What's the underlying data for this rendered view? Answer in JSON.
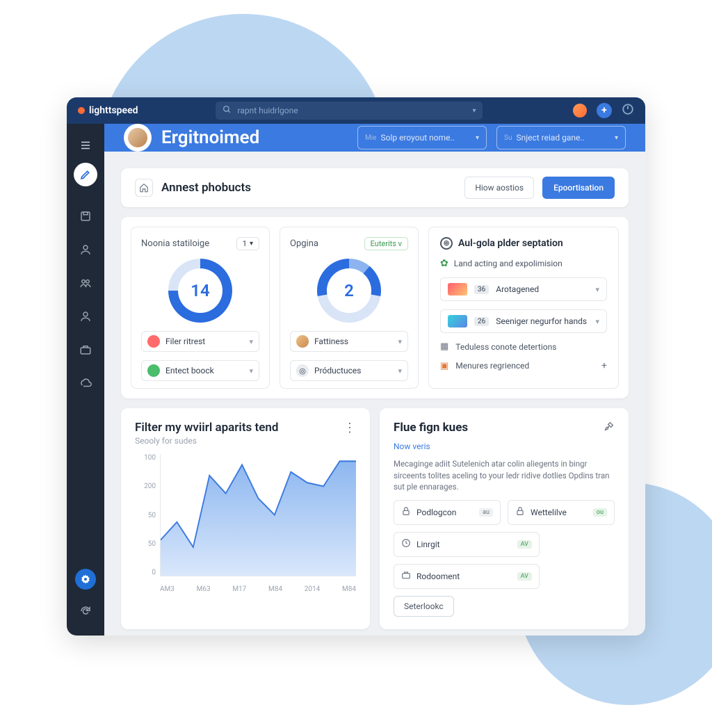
{
  "brand": "lighttspeed",
  "search": {
    "placeholder": "rapnt huidrlgone"
  },
  "hero": {
    "title": "Ergitnoimed",
    "select1_prefix": "Mie",
    "select1": "Solp eroyout nome..",
    "select2_prefix": "Su",
    "select2": "Snject reiad gane.."
  },
  "toolbar": {
    "title": "Annest phobucts",
    "btn_outline": "Hiow aostios",
    "btn_primary": "Epoortisation"
  },
  "gauge1": {
    "title": "Noonia statiloige",
    "badge": "1",
    "value": "14",
    "dd1": "Filer ritrest",
    "dd2": "Entect boock"
  },
  "gauge2": {
    "title": "Opgina",
    "badge": "Euterits v",
    "value": "2",
    "dd1": "Fattiness",
    "dd2": "Próductuces"
  },
  "rpanel": {
    "title": "Aul-gola plder septation",
    "sub": "Land acting and expolimision",
    "row1_num": "36",
    "row1": "Arotagened",
    "row2_num": "26",
    "row2": "Seeniger negurfor hands",
    "line1": "Teduless conote detertions",
    "line2": "Menures regrienced"
  },
  "chart": {
    "title": "Filter my wviirl aparits tend",
    "sub": "Seooly for sudes"
  },
  "chart_data": {
    "type": "area",
    "title": "Filter my wviirl aparits tend",
    "xlabel": "",
    "ylabel": "",
    "ytick_labels": [
      "100",
      "200",
      "50",
      "50",
      "0"
    ],
    "categories": [
      "AM3",
      "M63",
      "M17",
      "M84",
      "2014",
      "M84"
    ],
    "series": [
      {
        "name": "main",
        "values": [
          40,
          60,
          30,
          95,
          80,
          100,
          78,
          65,
          98,
          90,
          85,
          100
        ]
      }
    ],
    "ylim": [
      0,
      100
    ]
  },
  "info": {
    "title": "Flue fign kues",
    "link": "Now veris",
    "body": "Mecaginge adiit Sutelenich atar colin aliegents in bingr sirceents tolites aceling to your ledr ridive dotlies Opdins tran sut ple ennarages.",
    "items": [
      {
        "icon": "lock",
        "label": "Podlogcon",
        "tag": "au",
        "tag_style": "gray"
      },
      {
        "icon": "lock",
        "label": "Wettelilve",
        "tag": "ou",
        "tag_style": "green"
      },
      {
        "icon": "clock",
        "label": "Linrgit",
        "tag": "AV",
        "tag_style": "green"
      },
      {
        "icon": "briefcase",
        "label": "Rodooment",
        "tag": "AV",
        "tag_style": "green"
      }
    ],
    "btn": "Seterlookc"
  }
}
